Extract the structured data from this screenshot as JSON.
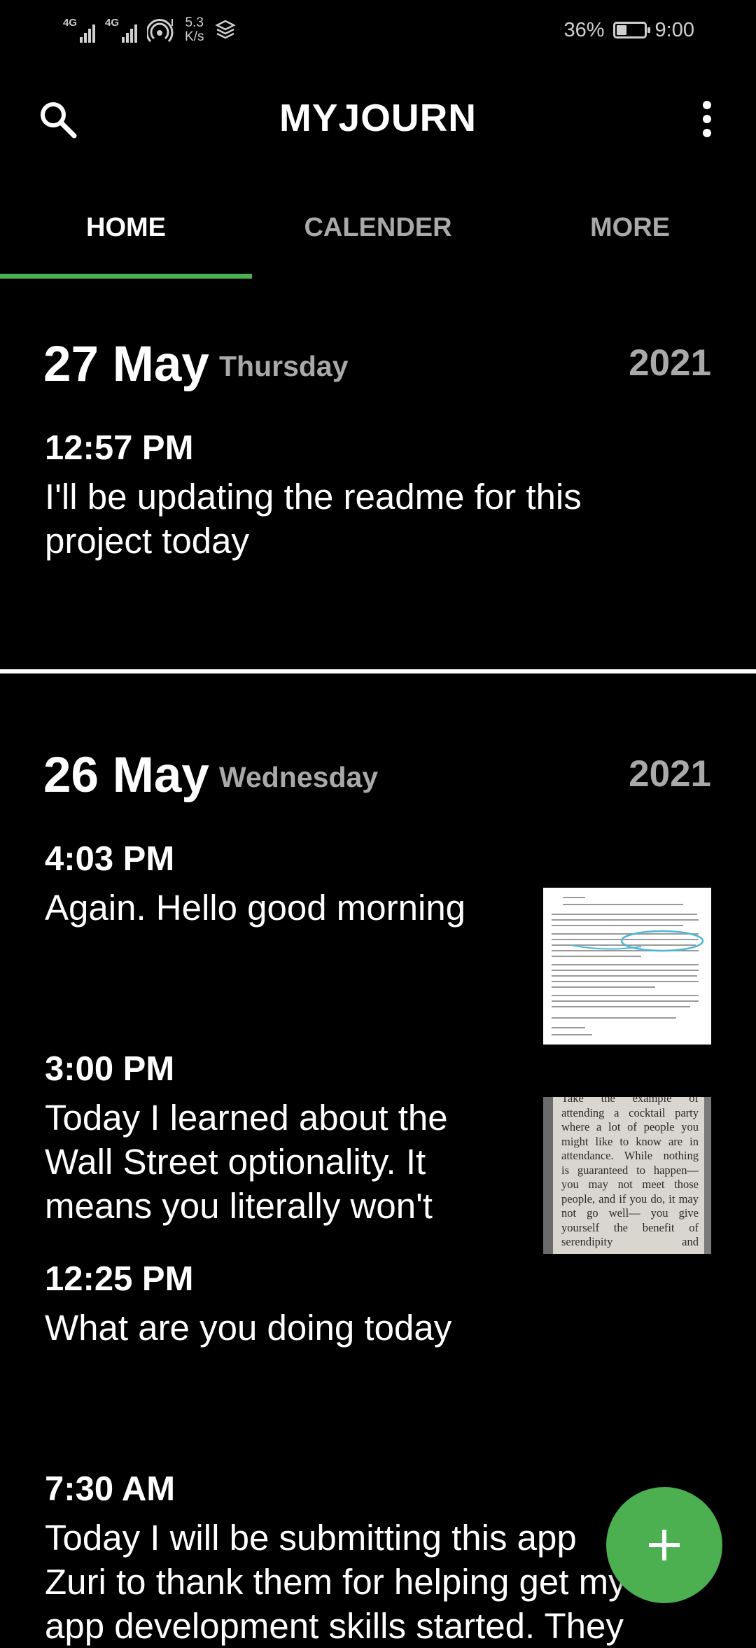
{
  "status_bar": {
    "network1": "4G",
    "network2": "4G",
    "speed_value": "5.3",
    "speed_unit": "K/s",
    "battery_text": "36%",
    "battery_level": 0.36,
    "time": "9:00"
  },
  "app_bar": {
    "title": "MYJOURN",
    "search_icon": "search-icon",
    "menu_icon": "more-vert-icon"
  },
  "tabs": [
    {
      "label": "HOME",
      "active": true
    },
    {
      "label": "CALENDER",
      "active": false
    },
    {
      "label": "MORE",
      "active": false
    }
  ],
  "days": [
    {
      "date": "27 May",
      "weekday": "Thursday",
      "year": "2021",
      "entries": [
        {
          "time": "12:57 PM",
          "text_lines": [
            "I'll be updating the readme for this",
            "project today"
          ]
        }
      ]
    },
    {
      "date": "26 May",
      "weekday": "Wednesday",
      "year": "2021",
      "entries": [
        {
          "time": "4:03 PM",
          "text_lines": [
            "Again. Hello good morning"
          ],
          "has_image": true
        },
        {
          "time": "3:00 PM",
          "text_lines": [
            "Today I learned about the",
            "Wall Street optionality. It",
            "means you literally won't"
          ],
          "has_image": true
        },
        {
          "time": "12:25 PM",
          "text_lines": [
            "What are you doing today"
          ]
        },
        {
          "time": "7:30 AM",
          "text_lines": [
            "Today I will be submitting this app",
            "Zuri to thank them for helping get my",
            "app development skills started. They"
          ]
        }
      ]
    }
  ],
  "thumb_book_lines": [
    "Take the example of",
    "attending a cocktail party",
    "where a lot of people you",
    "might like to know are in",
    "attendance. While nothing",
    "is guaranteed to happen—",
    "you may not meet those",
    "people, and if you do, it may",
    "not go well— you give",
    "yourself the benefit of",
    "serendipity        and"
  ],
  "fab": {
    "icon": "add-icon"
  },
  "colors": {
    "background": "#000000",
    "accent": "#4caf50",
    "secondary_text": "#a9a9a9"
  }
}
